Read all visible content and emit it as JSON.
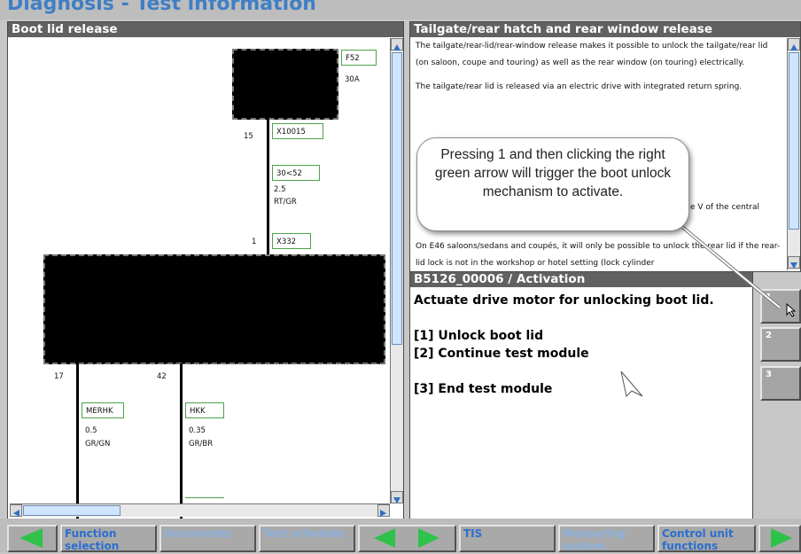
{
  "app_title": "Diagnosis - Test information",
  "left_pane": {
    "title": "Boot lid release",
    "diagram": {
      "fuse_label": "F52",
      "fuse_rating": "30A",
      "pin_top": "15",
      "connector_top": "X10015",
      "wire_top_id": "30<52",
      "wire_top_size": "2.5",
      "wire_top_color": "RT/GR",
      "pin_mid": "1",
      "connector_mid": "X332",
      "pin_left": "17",
      "pin_right": "42",
      "wire_left_id": "MERHK",
      "wire_left_size": "0.5",
      "wire_left_color": "GR/GN",
      "wire_right_id": "HKK",
      "wire_right_size": "0.35",
      "wire_right_color": "GR/BR"
    }
  },
  "info_pane": {
    "title": "Tailgate/rear hatch and rear window release",
    "paragraphs": [
      "The tailgate/rear-lid/rear-window release makes it possible to unlock the tailgate/rear lid (on saloon, coupe and touring) as well as the rear window (on touring) electrically.",
      "The tailgate/rear lid is released via an electric drive with integrated return spring."
    ],
    "fragment_1": "e V of the central",
    "fragment_2": "On E46 saloons/sedans and coupés, it will only be possible to unlock the rear lid if the rear-lid lock is not in the workshop or hotel setting (lock cylinder"
  },
  "activation_pane": {
    "title": "B5126_00006 / Activation",
    "heading": "Actuate drive motor for unlocking boot lid.",
    "option_1": "[1] Unlock boot lid",
    "option_2": "[2] Continue test module",
    "option_3": "[3] End test module"
  },
  "side_keys": [
    "1",
    "2",
    "3"
  ],
  "callout": {
    "text": "Pressing 1 and then clicking the right green arrow will trigger the boot unlock mechanism to activate."
  },
  "bottom_bar": {
    "function_selection": "Function selection",
    "documents": "Documents",
    "test_schedule": "Test schedule",
    "tis": "TIS",
    "measuring_system": "Measuring system",
    "control_unit_functions": "Control unit functions"
  },
  "colors": {
    "header_bg": "#616161",
    "arrow_green": "#2fc24a",
    "button_text_active": "#2a6fd0",
    "button_text_inactive": "#8cb2e0",
    "wire_box_border": "#4aa34a"
  },
  "icons": [
    "left-arrow-icon",
    "right-arrow-icon",
    "mouse-cursor-icon"
  ]
}
